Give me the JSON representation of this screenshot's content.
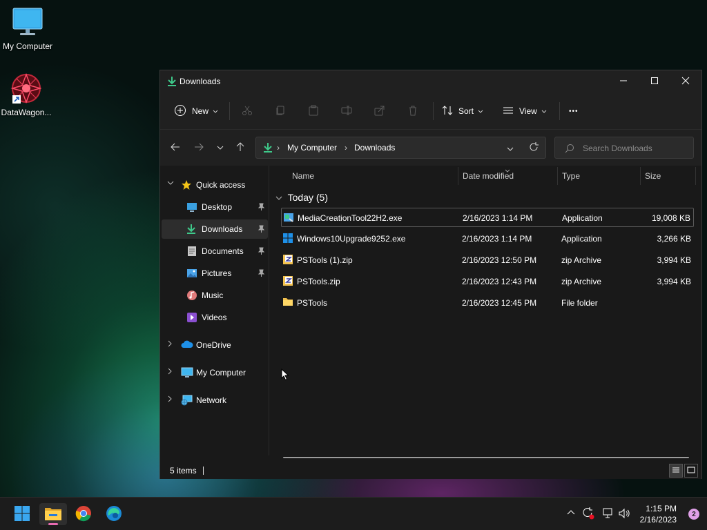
{
  "desktop": {
    "icons": [
      {
        "label": "My Computer",
        "icon": "monitor-icon"
      },
      {
        "label": "DataWagon...",
        "icon": "datawagon-shortcut-icon"
      }
    ]
  },
  "window": {
    "title": "Downloads",
    "controls": {
      "minimize": "minimize-icon",
      "maximize": "maximize-icon",
      "close": "close-icon"
    }
  },
  "toolbar": {
    "new_label": "New",
    "sort_label": "Sort",
    "view_label": "View",
    "more_label": "•••"
  },
  "address": {
    "crumbs": [
      "My Computer",
      "Downloads"
    ],
    "search_placeholder": "Search Downloads"
  },
  "sidebar": {
    "quick_access": "Quick access",
    "items": [
      {
        "label": "Desktop",
        "pinned": true,
        "icon": "desktop-folder-icon"
      },
      {
        "label": "Downloads",
        "pinned": true,
        "icon": "download-icon",
        "selected": true
      },
      {
        "label": "Documents",
        "pinned": true,
        "icon": "documents-icon"
      },
      {
        "label": "Pictures",
        "pinned": true,
        "icon": "pictures-icon"
      },
      {
        "label": "Music",
        "pinned": false,
        "icon": "music-icon"
      },
      {
        "label": "Videos",
        "pinned": false,
        "icon": "videos-icon"
      }
    ],
    "roots": [
      {
        "label": "OneDrive",
        "icon": "onedrive-icon"
      },
      {
        "label": "My Computer",
        "icon": "computer-icon"
      },
      {
        "label": "Network",
        "icon": "network-icon"
      }
    ]
  },
  "columns": {
    "name": "Name",
    "date": "Date modified",
    "type": "Type",
    "size": "Size"
  },
  "group_label": "Today (5)",
  "files": [
    {
      "name": "MediaCreationTool22H2.exe",
      "date": "2/16/2023 1:14 PM",
      "type": "Application",
      "size": "19,008 KB",
      "icon": "media-creation-icon"
    },
    {
      "name": "Windows10Upgrade9252.exe",
      "date": "2/16/2023 1:14 PM",
      "type": "Application",
      "size": "3,266 KB",
      "icon": "windows-logo-icon"
    },
    {
      "name": "PSTools (1).zip",
      "date": "2/16/2023 12:50 PM",
      "type": "zip Archive",
      "size": "3,994 KB",
      "icon": "zip-icon"
    },
    {
      "name": "PSTools.zip",
      "date": "2/16/2023 12:43 PM",
      "type": "zip Archive",
      "size": "3,994 KB",
      "icon": "zip-icon"
    },
    {
      "name": "PSTools",
      "date": "2/16/2023 12:45 PM",
      "type": "File folder",
      "size": "",
      "icon": "folder-icon"
    }
  ],
  "status": {
    "items": "5 items"
  },
  "taskbar": {
    "time": "1:15 PM",
    "date": "2/16/2023",
    "notifications": "2"
  },
  "colors": {
    "accent": "#0078d4",
    "download_green": "#3ec98a",
    "folder": "#f2c14e"
  }
}
